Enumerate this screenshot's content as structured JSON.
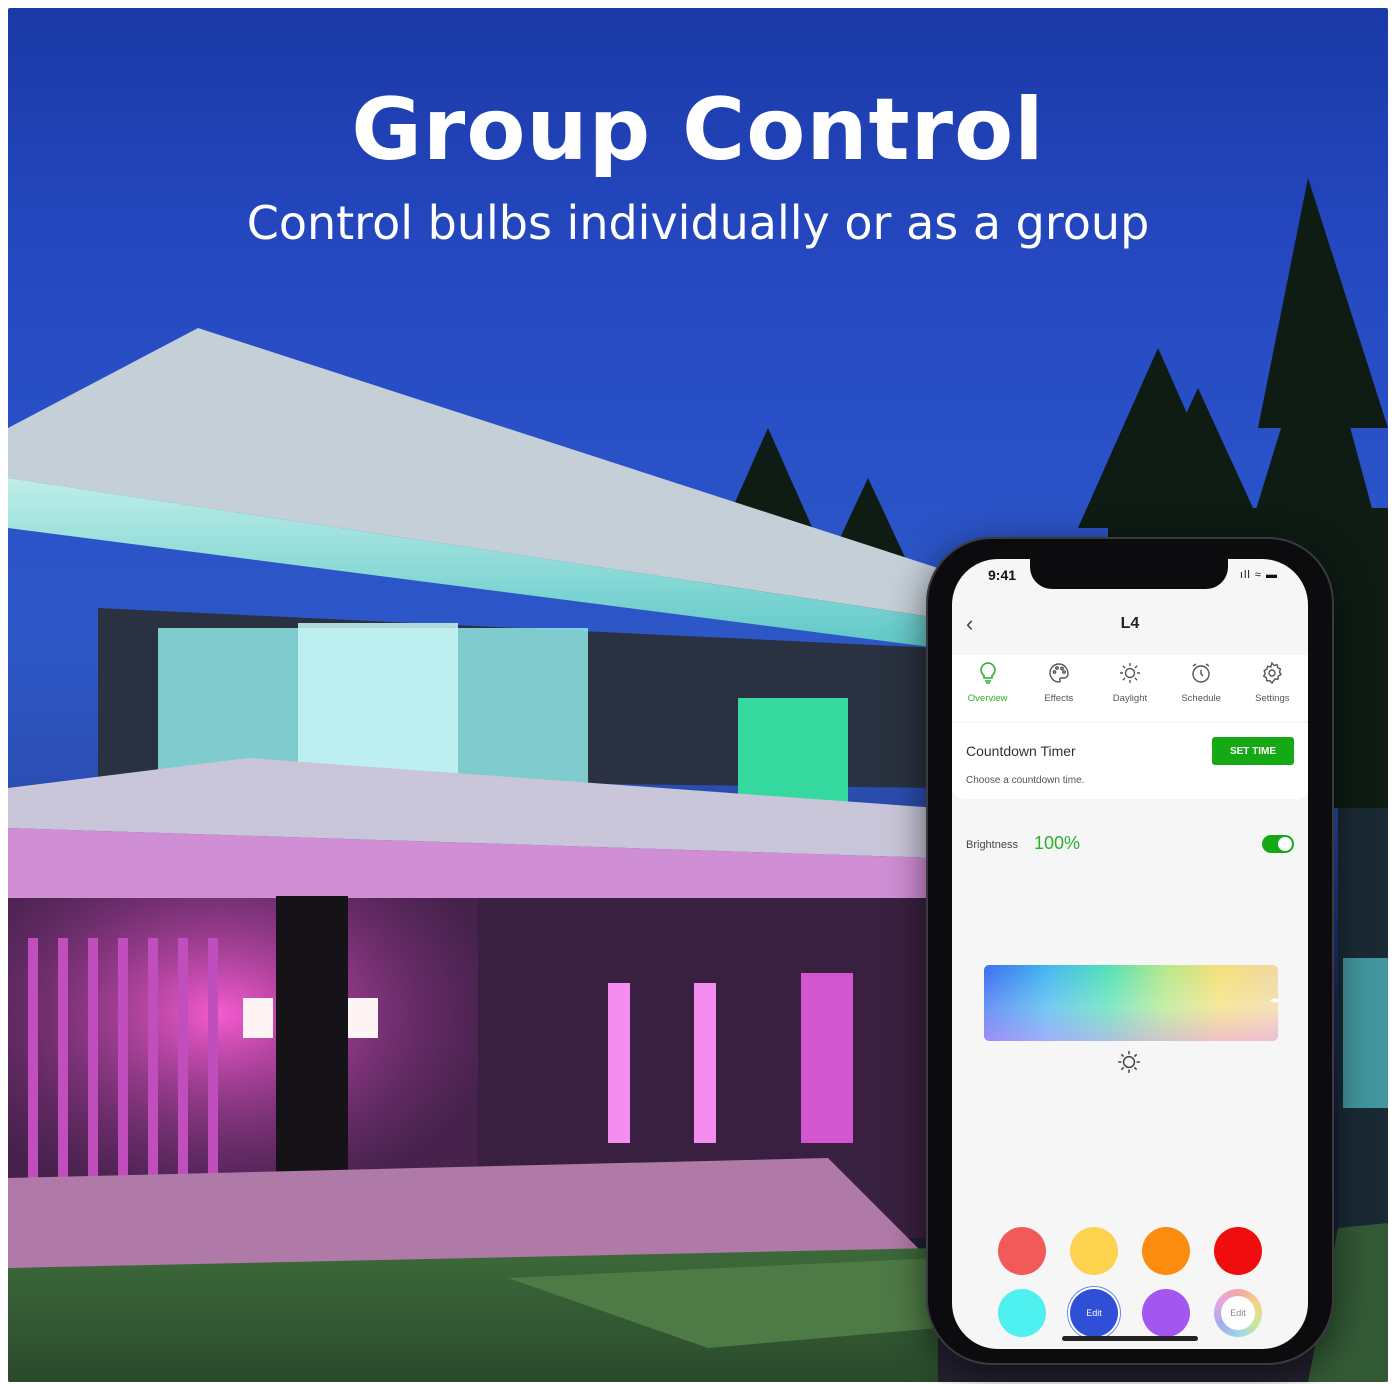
{
  "banner": {
    "title": "Group Control",
    "subtitle": "Control bulbs individually or as a group"
  },
  "phone": {
    "status_time": "9:41",
    "status_icons": "ıll ≈ ▬",
    "nav": {
      "back_glyph": "‹",
      "title": "L4"
    },
    "tabs": [
      {
        "label": "Overview",
        "icon": "bulb-icon",
        "active": true
      },
      {
        "label": "Effects",
        "icon": "palette-icon",
        "active": false
      },
      {
        "label": "Daylight",
        "icon": "sun-icon",
        "active": false
      },
      {
        "label": "Schedule",
        "icon": "alarm-clock-icon",
        "active": false
      },
      {
        "label": "Settings",
        "icon": "gear-icon",
        "active": false
      }
    ],
    "countdown": {
      "title": "Countdown Timer",
      "subtitle": "Choose a countdown time.",
      "button": "SET TIME"
    },
    "brightness": {
      "label": "Brightness",
      "value": "100%",
      "enabled": true
    },
    "swatches": [
      {
        "color": "#f25a5a",
        "label": ""
      },
      {
        "color": "#fcd24e",
        "label": ""
      },
      {
        "color": "#fb8c0f",
        "label": ""
      },
      {
        "color": "#f00d0d",
        "label": ""
      },
      {
        "color": "#4ff0f0",
        "label": ""
      },
      {
        "color": "#2f4fd6",
        "label": "Edit"
      },
      {
        "color": "#a456f0",
        "label": ""
      },
      {
        "color": "wheel",
        "label": "Edit"
      }
    ]
  },
  "colors": {
    "accent_green": "#16a916",
    "text_green": "#2bb02b"
  }
}
